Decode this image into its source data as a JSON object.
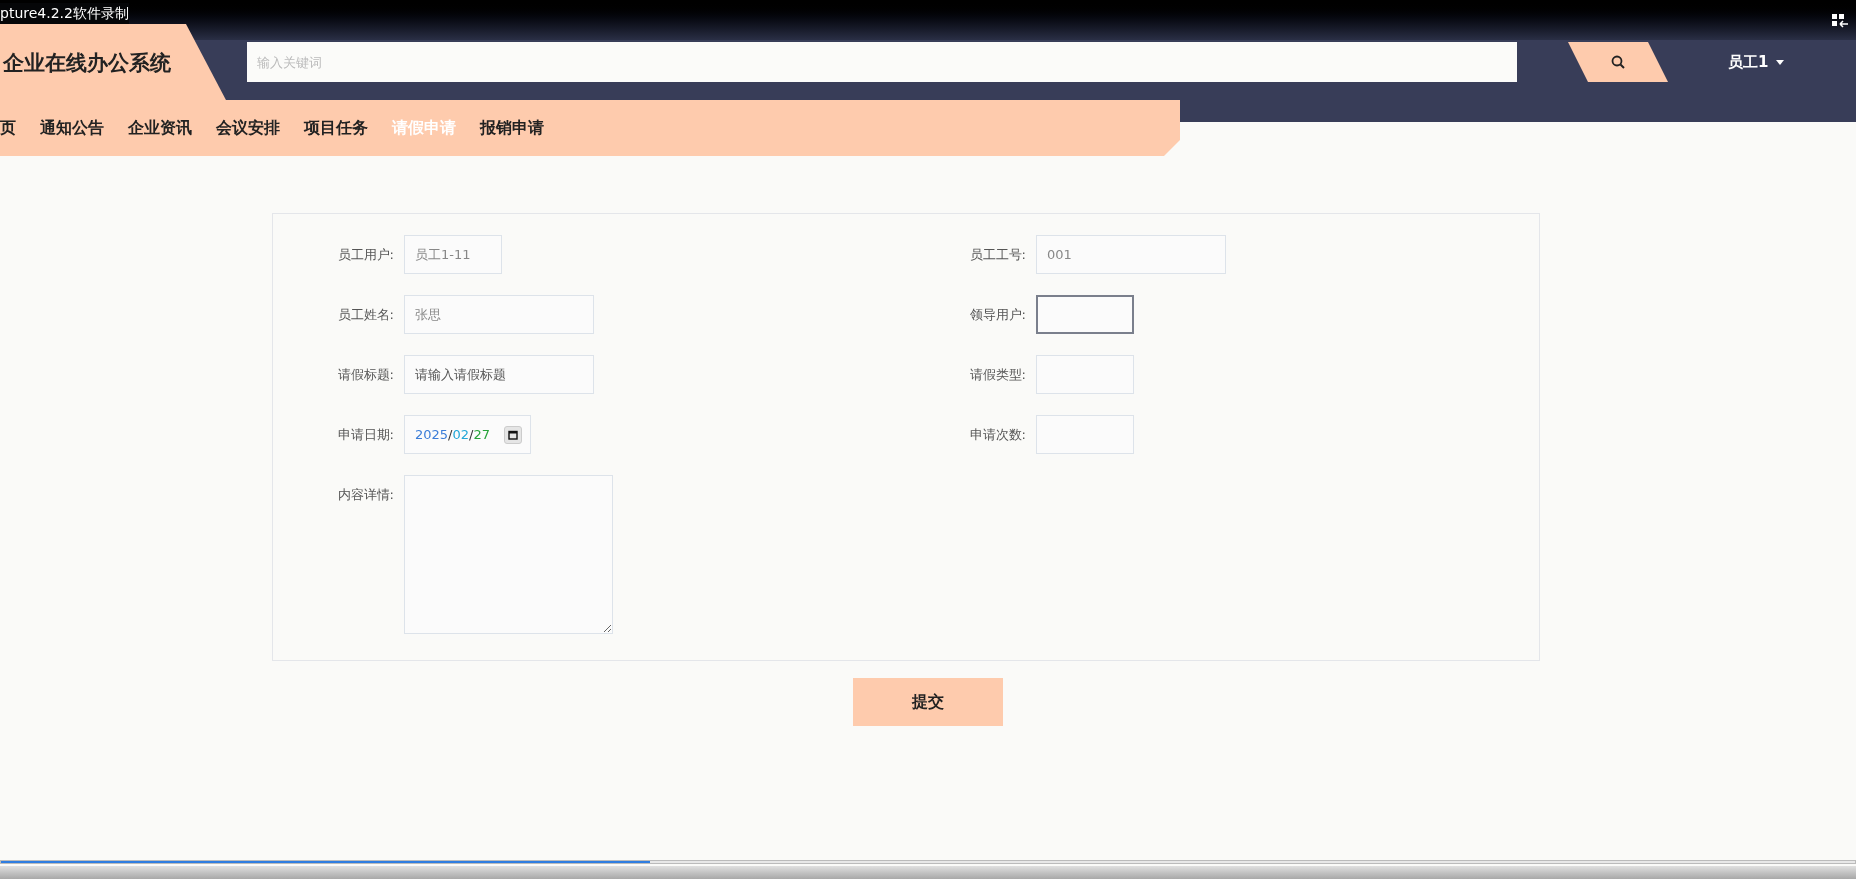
{
  "recorder": {
    "title": "pture4.2.2软件录制",
    "level": 0.35
  },
  "header": {
    "logo": "企业在线办公系统",
    "search": {
      "placeholder": "输入关键词"
    },
    "user": "员工1"
  },
  "nav": [
    {
      "label": "页",
      "selected": false
    },
    {
      "label": "通知公告",
      "selected": false
    },
    {
      "label": "企业资讯",
      "selected": false
    },
    {
      "label": "会议安排",
      "selected": false
    },
    {
      "label": "项目任务",
      "selected": false
    },
    {
      "label": "请假申请",
      "selected": true
    },
    {
      "label": "报销申请",
      "selected": false
    }
  ],
  "form": {
    "left": [
      {
        "kind": "input",
        "label": "员工用户:",
        "value": "员工1-11",
        "focused": false
      },
      {
        "kind": "input",
        "label": "员工姓名:",
        "value": "张思",
        "focused": false
      },
      {
        "kind": "input",
        "label": "请假标题:",
        "placeholder": "请输入请假标题",
        "focused": false
      },
      {
        "kind": "date",
        "label": "申请日期:",
        "value": "2025/02/27",
        "focused": false
      },
      {
        "kind": "textarea",
        "label": "内容详情:",
        "focused": false
      }
    ],
    "right": [
      {
        "kind": "input",
        "label": "员工工号:",
        "value": "001",
        "focused": false
      },
      {
        "kind": "input",
        "label": "领导用户:",
        "focused": true
      },
      {
        "kind": "input",
        "label": "请假类型:",
        "focused": false
      },
      {
        "kind": "input",
        "label": "申请次数:",
        "focused": false
      }
    ],
    "submit": "提交"
  }
}
